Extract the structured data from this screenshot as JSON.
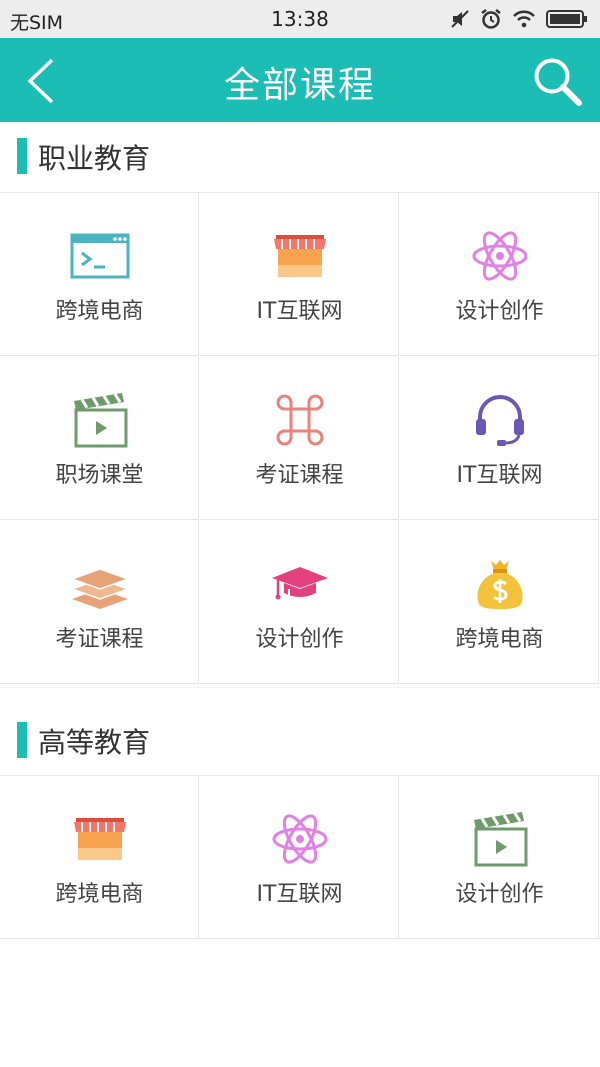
{
  "status_bar": {
    "carrier": "无SIM",
    "time": "13:38"
  },
  "header": {
    "title": "全部课程",
    "back_icon": "chevron-left-icon",
    "search_icon": "search-icon"
  },
  "sections": [
    {
      "title": "职业教育",
      "items": [
        {
          "label": "跨境电商",
          "icon": "terminal-window-icon"
        },
        {
          "label": "IT互联网",
          "icon": "storefront-icon"
        },
        {
          "label": "设计创作",
          "icon": "atom-icon"
        },
        {
          "label": "职场课堂",
          "icon": "clapperboard-icon"
        },
        {
          "label": "考证课程",
          "icon": "command-key-icon"
        },
        {
          "label": "IT互联网",
          "icon": "headset-icon"
        },
        {
          "label": "考证课程",
          "icon": "layers-icon"
        },
        {
          "label": "设计创作",
          "icon": "graduation-cap-icon"
        },
        {
          "label": "跨境电商",
          "icon": "money-bag-icon"
        }
      ]
    },
    {
      "title": "高等教育",
      "items": [
        {
          "label": "跨境电商",
          "icon": "storefront-icon"
        },
        {
          "label": "IT互联网",
          "icon": "atom-icon"
        },
        {
          "label": "设计创作",
          "icon": "clapperboard-icon"
        }
      ]
    }
  ],
  "colors": {
    "accent": "#1bbdb4"
  }
}
